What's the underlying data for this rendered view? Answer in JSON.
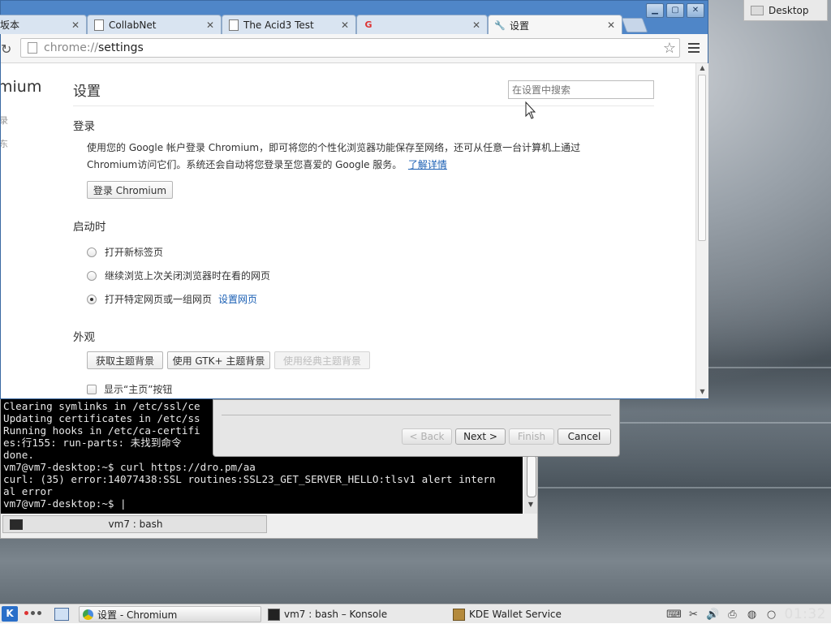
{
  "browser": {
    "tabs": [
      {
        "label": "坂本",
        "icon": "page-icon"
      },
      {
        "label": "CollabNet",
        "icon": "page-icon"
      },
      {
        "label": "The Acid3 Test",
        "icon": "page-icon"
      },
      {
        "label": "",
        "icon": "google-icon"
      },
      {
        "label": "设置",
        "icon": "wrench-icon"
      }
    ],
    "url_scheme": "chrome://",
    "url_host": "settings",
    "window_controls": {
      "minimize": "▁",
      "maximize": "▢",
      "close": "✕"
    }
  },
  "settings": {
    "nav_title": "mium",
    "nav_fragments": [
      "录",
      "东"
    ],
    "page_title": "设置",
    "search_placeholder": "在设置中搜索",
    "signin": {
      "heading": "登录",
      "line1": "使用您的 Google 帐户登录 Chromium，即可将您的个性化浏览器功能保存至网络，还可从任意一台计算机上通过",
      "line2": "Chromium访问它们。系统还会自动将您登录至您喜爱的 Google 服务。",
      "learn_more": "了解详情",
      "button": "登录 Chromium"
    },
    "startup": {
      "heading": "启动时",
      "options": [
        {
          "label": "打开新标签页",
          "checked": false
        },
        {
          "label": "继续浏览上次关闭浏览器时在看的网页",
          "checked": false
        },
        {
          "label": "打开特定网页或一组网页",
          "checked": true
        }
      ],
      "set_pages_link": "设置网页"
    },
    "appearance": {
      "heading": "外观",
      "buttons": [
        {
          "label": "获取主题背景",
          "disabled": false
        },
        {
          "label": "使用 GTK+ 主题背景",
          "disabled": false
        },
        {
          "label": "使用经典主题背景",
          "disabled": true
        }
      ],
      "show_home": "显示“主页”按钮"
    }
  },
  "terminal": {
    "lines": [
      "Clearing symlinks in /etc/ssl/ce",
      "Updating certificates in /etc/ss",
      "Running hooks in /etc/ca-certifi",
      "es:行155: run-parts: 未找到命令",
      "done.",
      "vm7@vm7-desktop:~$ curl https://dro.pm/aa",
      "curl: (35) error:14077438:SSL routines:SSL23_GET_SERVER_HELLO:tlsv1 alert intern",
      "al error",
      "vm7@vm7-desktop:~$ |"
    ],
    "tab_label": "vm7 : bash"
  },
  "wizard": {
    "back": "< Back",
    "next": "Next >",
    "finish": "Finish",
    "cancel": "Cancel"
  },
  "desktop_button": "Desktop",
  "taskbar": {
    "kmenu": "K",
    "tasks": [
      {
        "label": "设置 - Chromium",
        "active": true
      },
      {
        "label": "vm7 : bash – Konsole",
        "active": false
      },
      {
        "label": "KDE Wallet Service",
        "active": false
      }
    ],
    "clock": "01:32"
  }
}
